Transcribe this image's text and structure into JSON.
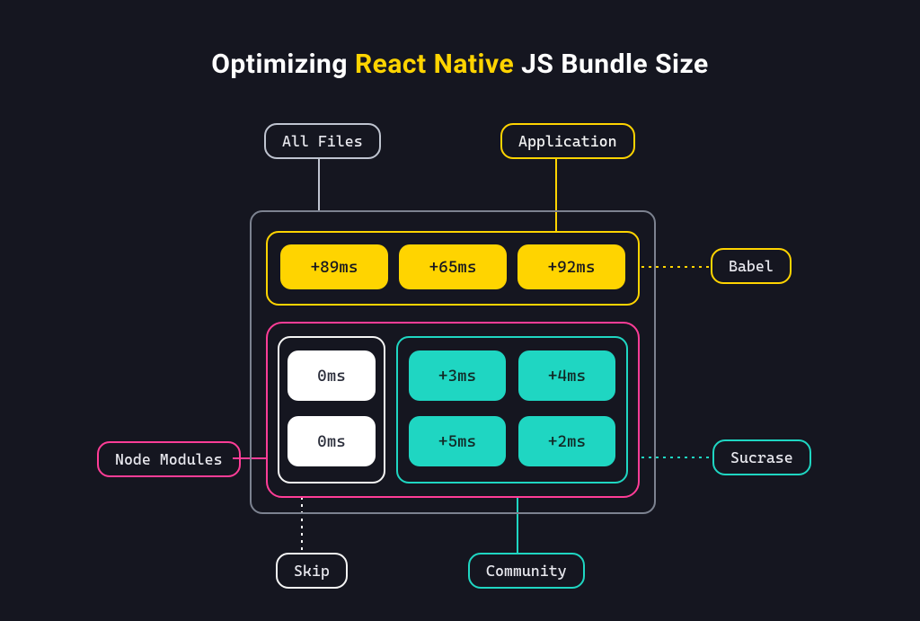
{
  "title": {
    "pre": "Optimizing ",
    "accent": "React Native",
    "post": " JS Bundle Size"
  },
  "labels": {
    "all_files": "All Files",
    "application": "Application",
    "babel": "Babel",
    "node_modules": "Node Modules",
    "sucrase": "Sucrase",
    "skip": "Skip",
    "community": "Community"
  },
  "groups": {
    "babel": {
      "values": [
        "+89ms",
        "+65ms",
        "+92ms"
      ]
    },
    "skip": {
      "values": [
        "0ms",
        "0ms"
      ]
    },
    "sucrase": {
      "values": [
        "+3ms",
        "+4ms",
        "+5ms",
        "+2ms"
      ]
    }
  },
  "colors": {
    "bg": "#151620",
    "yellow": "#ffd400",
    "pink": "#ff3d97",
    "teal": "#1fd6c2",
    "white": "#ffffff",
    "gray": "#7c8290"
  }
}
